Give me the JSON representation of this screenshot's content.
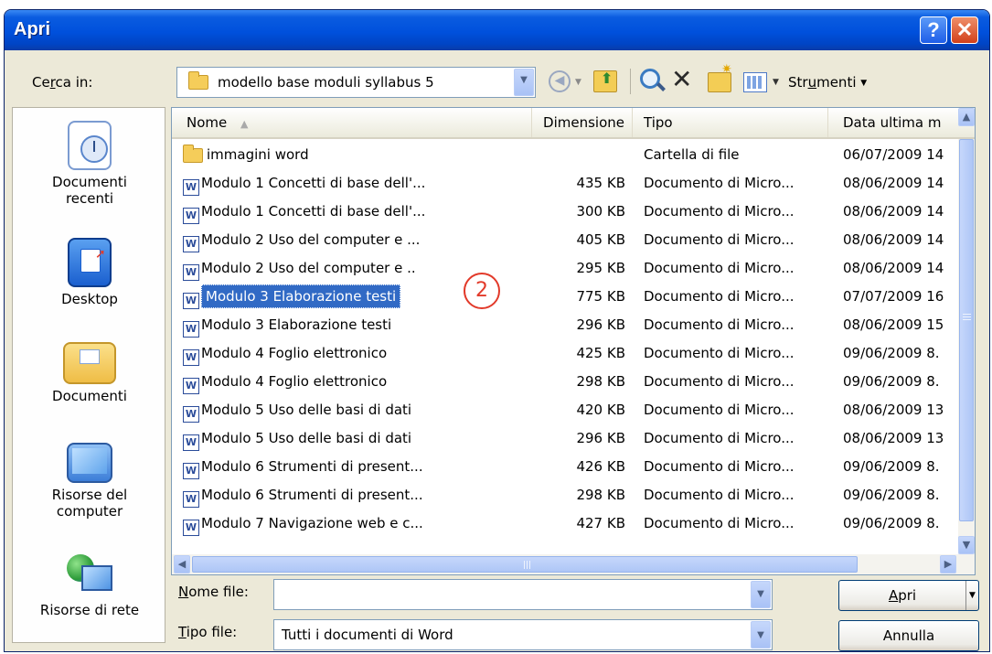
{
  "window": {
    "title": "Apri",
    "help_glyph": "?",
    "close_glyph": "✕"
  },
  "look_in": {
    "label_prefix": "Ce",
    "label_hotkey": "r",
    "label_suffix": "ca in:",
    "value": "modello base moduli syllabus 5",
    "tools_prefix": "Str",
    "tools_hotkey": "u",
    "tools_suffix": "menti"
  },
  "places": [
    {
      "label_line1": "Documenti",
      "label_line2": "recenti",
      "icon": "recent-documents-icon"
    },
    {
      "label_line1": "Desktop",
      "label_line2": "",
      "icon": "desktop-icon"
    },
    {
      "label_line1": "Documenti",
      "label_line2": "",
      "icon": "my-documents-icon"
    },
    {
      "label_line1": "Risorse del",
      "label_line2": "computer",
      "icon": "my-computer-icon"
    },
    {
      "label_line1": "Risorse di rete",
      "label_line2": "",
      "icon": "network-icon"
    }
  ],
  "columns": {
    "name": "Nome",
    "size": "Dimensione",
    "type": "Tipo",
    "date": "Data ultima m"
  },
  "files": [
    {
      "name": "immagini word",
      "size": "",
      "type": "Cartella di file",
      "date": "06/07/2009 14",
      "kind": "folder"
    },
    {
      "name": "Modulo 1 Concetti di base dell'...",
      "size": "435 KB",
      "type": "Documento di Micro...",
      "date": "08/06/2009 14",
      "kind": "doc"
    },
    {
      "name": "Modulo 1 Concetti di base dell'...",
      "size": "300 KB",
      "type": "Documento di Micro...",
      "date": "08/06/2009 14",
      "kind": "doc"
    },
    {
      "name": "Modulo 2 Uso del computer e ...",
      "size": "405 KB",
      "type": "Documento di Micro...",
      "date": "08/06/2009 14",
      "kind": "doc"
    },
    {
      "name": "Modulo 2 Uso del computer e ..",
      "size": "295 KB",
      "type": "Documento di Micro...",
      "date": "08/06/2009 14",
      "kind": "doc"
    },
    {
      "name": "Modulo 3 Elaborazione testi",
      "size": "775 KB",
      "type": "Documento di Micro...",
      "date": "07/07/2009 16",
      "kind": "doc"
    },
    {
      "name": "Modulo 3 Elaborazione testi",
      "size": "296 KB",
      "type": "Documento di Micro...",
      "date": "08/06/2009 15",
      "kind": "doc"
    },
    {
      "name": "Modulo 4 Foglio elettronico",
      "size": "425 KB",
      "type": "Documento di Micro...",
      "date": "09/06/2009 8.",
      "kind": "doc"
    },
    {
      "name": "Modulo 4 Foglio elettronico",
      "size": "298 KB",
      "type": "Documento di Micro...",
      "date": "09/06/2009 8.",
      "kind": "doc"
    },
    {
      "name": "Modulo 5 Uso delle basi di dati",
      "size": "420 KB",
      "type": "Documento di Micro...",
      "date": "08/06/2009 13",
      "kind": "doc"
    },
    {
      "name": "Modulo 5 Uso delle basi di dati",
      "size": "296 KB",
      "type": "Documento di Micro...",
      "date": "08/06/2009 13",
      "kind": "doc"
    },
    {
      "name": "Modulo 6 Strumenti di present...",
      "size": "426 KB",
      "type": "Documento di Micro...",
      "date": "09/06/2009 8.",
      "kind": "doc"
    },
    {
      "name": "Modulo 6 Strumenti di present...",
      "size": "298 KB",
      "type": "Documento di Micro...",
      "date": "09/06/2009 8.",
      "kind": "doc"
    },
    {
      "name": "Modulo 7 Navigazione web e c...",
      "size": "427 KB",
      "type": "Documento di Micro...",
      "date": "09/06/2009 8.",
      "kind": "doc"
    }
  ],
  "selected_index": 5,
  "callout": "2",
  "filename": {
    "label_hotkey": "N",
    "label_rest": "ome file:",
    "value": ""
  },
  "filetype": {
    "label_hotkey": "T",
    "label_rest": "ipo file:",
    "value": "Tutti i documenti di Word"
  },
  "buttons": {
    "open_hotkey": "A",
    "open_rest": "pri",
    "cancel": "Annulla"
  }
}
